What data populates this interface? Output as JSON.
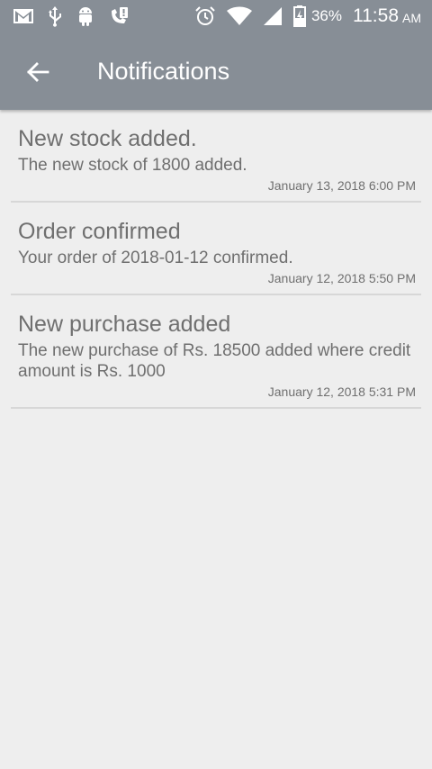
{
  "status_bar": {
    "battery_percent": "36%",
    "time": "11:58",
    "ampm": "AM",
    "left_icons": [
      "gmail-icon",
      "usb-icon",
      "android-icon",
      "wifi-call-icon"
    ],
    "right_icons": [
      "alarm-icon",
      "wifi-icon",
      "signal-icon",
      "battery-icon"
    ]
  },
  "app_bar": {
    "title": "Notifications",
    "back_icon": "arrow-back-icon",
    "background": "#878e96"
  },
  "notifications": [
    {
      "title": "New stock added.",
      "body": "The new stock of 1800 added.",
      "time": "January 13, 2018 6:00 PM"
    },
    {
      "title": "Order confirmed",
      "body": "Your order of 2018-01-12 confirmed.",
      "time": "January 12, 2018 5:50 PM"
    },
    {
      "title": "New purchase added",
      "body": "The new purchase of Rs. 18500 added where credit amount is Rs. 1000",
      "time": "January 12, 2018 5:31 PM"
    }
  ]
}
